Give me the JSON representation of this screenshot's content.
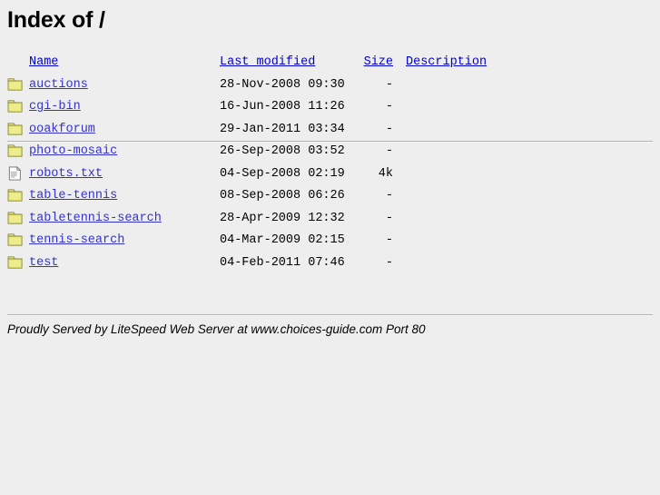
{
  "page": {
    "title": "Index of /",
    "background_color": "#eeeeee",
    "link_color": "#3333cc",
    "header_link_color": "#0000cc",
    "rule_color": "#b3b3b3"
  },
  "columns": {
    "name": "Name",
    "last_modified": "Last modified",
    "size": "Size",
    "description": "Description "
  },
  "entries": [
    {
      "icon": "folder-icon",
      "name": "auctions",
      "last_modified": "28-Nov-2008 09:30",
      "size": "-",
      "description": ""
    },
    {
      "icon": "folder-icon",
      "name": "cgi-bin",
      "last_modified": "16-Jun-2008 11:26",
      "size": "-",
      "description": ""
    },
    {
      "icon": "folder-icon",
      "name": "ooakforum",
      "last_modified": "29-Jan-2011 03:34",
      "size": "-",
      "description": ""
    },
    {
      "icon": "folder-icon",
      "name": "photo-mosaic",
      "last_modified": "26-Sep-2008 03:52",
      "size": "-",
      "description": ""
    },
    {
      "icon": "document-icon",
      "name": "robots.txt",
      "last_modified": "04-Sep-2008 02:19",
      "size": "4k",
      "description": ""
    },
    {
      "icon": "folder-icon",
      "name": "table-tennis",
      "last_modified": "08-Sep-2008 06:26",
      "size": "-",
      "description": ""
    },
    {
      "icon": "folder-icon",
      "name": "tabletennis-search",
      "last_modified": "28-Apr-2009 12:32",
      "size": "-",
      "description": ""
    },
    {
      "icon": "folder-icon",
      "name": "tennis-search",
      "last_modified": "04-Mar-2009 02:15",
      "size": "-",
      "description": ""
    },
    {
      "icon": "folder-icon",
      "name": "test",
      "last_modified": "04-Feb-2011 07:46",
      "size": "-",
      "description": ""
    }
  ],
  "footer": {
    "signature": "Proudly Served by LiteSpeed Web Server at www.choices-guide.com Port 80"
  }
}
